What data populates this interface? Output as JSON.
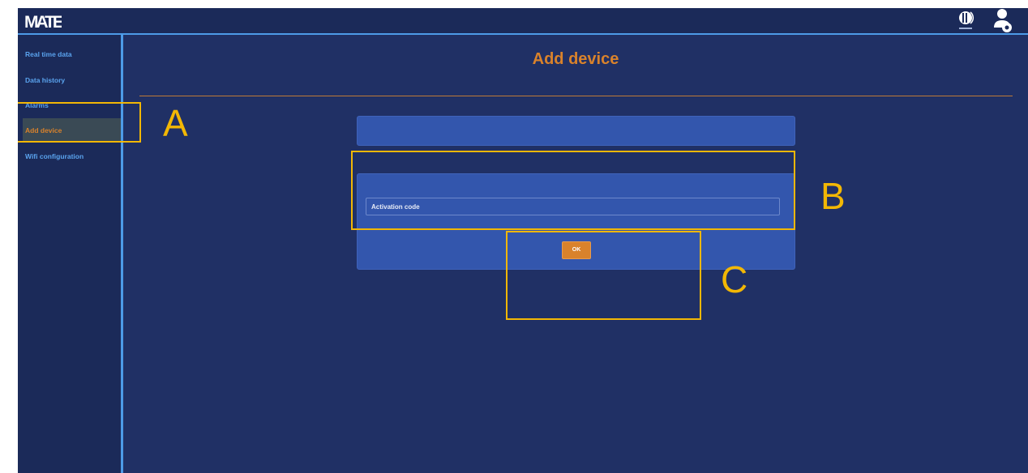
{
  "app": {
    "logo_text": "MATE",
    "brand_icon": "comau-logo-icon",
    "user_icon": "user-settings-icon"
  },
  "sidebar": {
    "items": [
      {
        "label": "Real time data",
        "active": false
      },
      {
        "label": "Data history",
        "active": false
      },
      {
        "label": "Alarms",
        "active": false
      },
      {
        "label": "Add device",
        "active": true
      },
      {
        "label": "Wifi configuration",
        "active": false
      }
    ]
  },
  "main": {
    "title": "Add device",
    "activation_input": {
      "value": "",
      "placeholder": "Activation code"
    },
    "ok_label": "OK"
  },
  "annotations": {
    "a": "A",
    "b": "B",
    "c": "C"
  },
  "colors": {
    "background": "#203065",
    "accent": "#d9822b",
    "nav_text": "#5aa3ee",
    "panel": "#3356ad",
    "annotation": "#f2b705"
  }
}
